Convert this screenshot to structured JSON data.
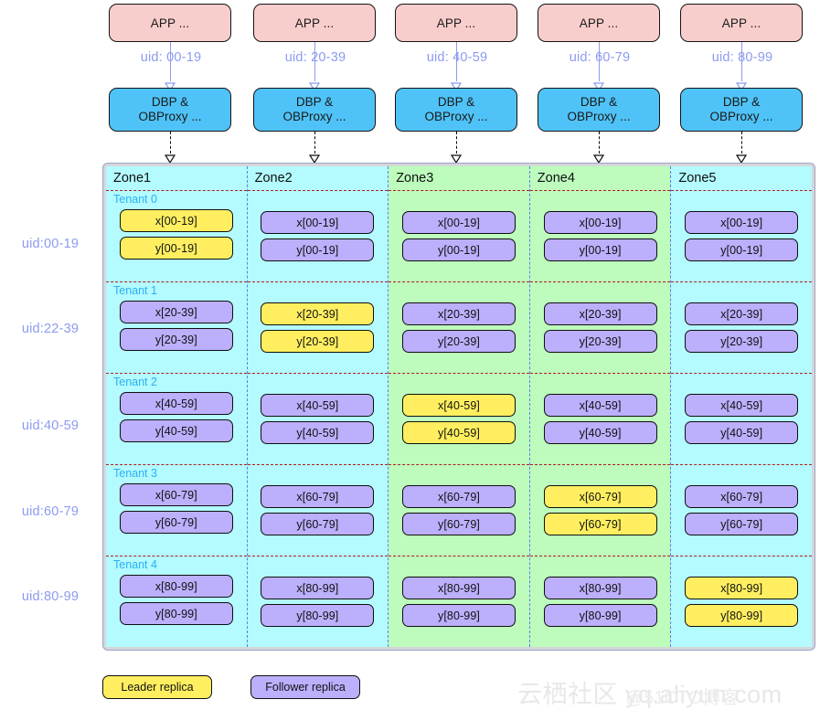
{
  "top_columns": [
    {
      "app_label": "APP ...",
      "uid_label": "uid: 00-19",
      "proxy_line1": "DBP &",
      "proxy_line2": "OBProxy ..."
    },
    {
      "app_label": "APP ...",
      "uid_label": "uid: 20-39",
      "proxy_line1": "DBP &",
      "proxy_line2": "OBProxy ..."
    },
    {
      "app_label": "APP ...",
      "uid_label": "uid: 40-59",
      "proxy_line1": "DBP &",
      "proxy_line2": "OBProxy ..."
    },
    {
      "app_label": "APP ...",
      "uid_label": "uid: 60-79",
      "proxy_line1": "DBP &",
      "proxy_line2": "OBProxy ..."
    },
    {
      "app_label": "APP ...",
      "uid_label": "uid: 80-99",
      "proxy_line1": "DBP &",
      "proxy_line2": "OBProxy ..."
    }
  ],
  "row_labels": [
    "uid:00-19",
    "uid:22-39",
    "uid:40-59",
    "uid:60-79",
    "uid:80-99"
  ],
  "zones": [
    {
      "title": "Zone1",
      "color": "cyan",
      "bg": "#b3fbff"
    },
    {
      "title": "Zone2",
      "color": "cyan",
      "bg": "#b3fbff"
    },
    {
      "title": "Zone3",
      "color": "green",
      "bg": "#bdfcbd"
    },
    {
      "title": "Zone4",
      "color": "green",
      "bg": "#bdfcbd"
    },
    {
      "title": "Zone5",
      "color": "cyan",
      "bg": "#b3fbff"
    }
  ],
  "tenants": [
    {
      "label": "Tenant 0",
      "x_label": "x[00-19]",
      "y_label": "y[00-19]",
      "leader_zone": 0
    },
    {
      "label": "Tenant 1",
      "x_label": "x[20-39]",
      "y_label": "y[20-39]",
      "leader_zone": 1
    },
    {
      "label": "Tenant 2",
      "x_label": "x[40-59]",
      "y_label": "y[40-59]",
      "leader_zone": 2
    },
    {
      "label": "Tenant 3",
      "x_label": "x[60-79]",
      "y_label": "y[60-79]",
      "leader_zone": 3
    },
    {
      "label": "Tenant 4",
      "x_label": "x[80-99]",
      "y_label": "y[80-99]",
      "leader_zone": 4
    }
  ],
  "legend": {
    "leader": "Leader replica",
    "follower": "Follower replica"
  },
  "watermark": {
    "main": "云栖社区 yq.aliyun.com",
    "sub": "@51CTO博客"
  },
  "colors": {
    "app_box": "#f8cecc",
    "proxy_box": "#4fc3f7",
    "leader_replica": "#ffef60",
    "follower_replica": "#bcaffc",
    "zone_cyan": "#b3fbff",
    "zone_green": "#bdfcbd",
    "uid_text": "#8c9bf0",
    "tenant_text": "#2bb0f5",
    "tenant_border": "#b02020",
    "zone_border": "#5b7cf0",
    "container_bg": "#d6d6d6"
  }
}
